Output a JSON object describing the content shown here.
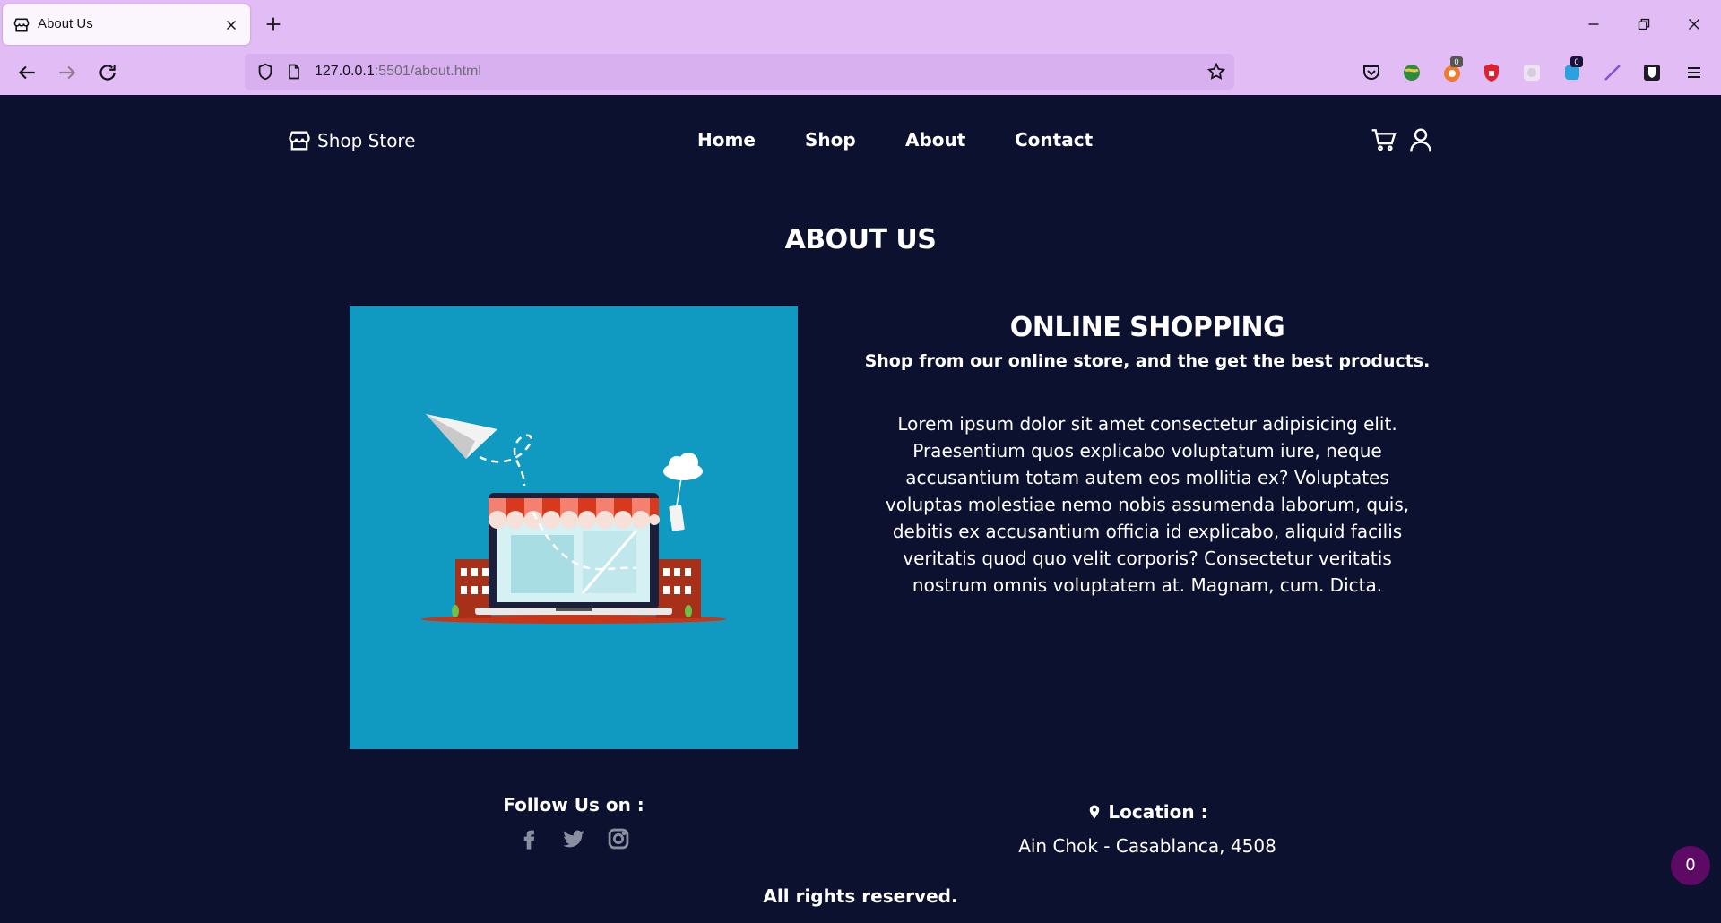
{
  "browser": {
    "tab_title": "About Us",
    "url_host": "127.0.0.1",
    "url_rest": ":5501/about.html",
    "extension_badges": [
      "0",
      "0"
    ]
  },
  "site": {
    "brand": "Shop Store",
    "nav": [
      "Home",
      "Shop",
      "About",
      "Contact"
    ]
  },
  "main": {
    "title": "ABOUT US",
    "heading": "ONLINE SHOPPING",
    "subtitle": "Shop from our online store, and the get the best products.",
    "body": "Lorem ipsum dolor sit amet consectetur adipisicing elit. Praesentium quos explicabo voluptatum iure, neque accusantium totam autem eos mollitia ex? Voluptates voluptas molestiae nemo nobis assumenda laborum, quis, debitis ex accusantium officia id explicabo, aliquid facilis veritatis quod quo velit corporis? Consectetur veritatis nostrum omnis voluptatem at. Magnam, cum. Dicta."
  },
  "footer": {
    "follow_title": "Follow Us on :",
    "socials": [
      "facebook-icon",
      "twitter-icon",
      "instagram-icon"
    ],
    "location_title": "Location :",
    "location_address": "Ain Chok - Casablanca, 4508",
    "rights": "All rights reserved."
  },
  "cart_count": "0",
  "colors": {
    "page_bg": "#0d1130",
    "chrome_bg": "#e2bdf5",
    "image_bg": "#119ac1",
    "cart_badge": "#5c0a63"
  }
}
